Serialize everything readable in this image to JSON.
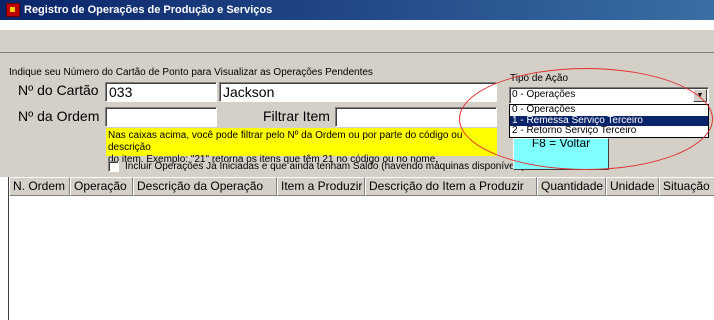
{
  "window": {
    "title": "Registro de Operações de Produção e Serviços"
  },
  "instruction": "Indique seu Número do Cartão de Ponto para Visualizar as Operações Pendentes",
  "cartao": {
    "label": "Nº do Cartão",
    "value": "033",
    "name_value": "Jackson"
  },
  "ordem": {
    "label": "Nº da Ordem",
    "value": ""
  },
  "filtrar_item": {
    "label": "Filtrar Item",
    "value": ""
  },
  "hint": {
    "line1": "Nas caixas acima, você pode filtrar pelo Nº da Ordem ou por parte do código ou descrição",
    "line2": "do item. Exemplo: \"21\" retorna os itens que têm 21 no código ou no nome."
  },
  "checkbox": {
    "label": "Incluir Operações Já Iniciadas e que ainda tenham Saldo (havendo máquinas disponíveis)",
    "checked": false
  },
  "tipo_acao": {
    "label": "Tipo de Ação",
    "selected": "0 - Operações",
    "options": [
      "0 - Operações",
      "1 - Remessa Serviço Terceiro",
      "2 - Retorno Serviço Terceiro"
    ],
    "highlighted_index": 1
  },
  "voltar_button": {
    "label": "F8 = Voltar"
  },
  "table": {
    "columns": [
      "N. Ordem",
      "Operação",
      "Descrição da Operação",
      "Item a Produzir",
      "Descrição do Item a Produzir",
      "Quantidade",
      "Unidade",
      "Situação"
    ],
    "rows": []
  },
  "colors": {
    "title_bar": "#0a246a",
    "hint_background": "#ffff00",
    "voltar_background": "#80ffff",
    "annotation_ellipse": "#e03030",
    "selection": "#0a246a"
  }
}
